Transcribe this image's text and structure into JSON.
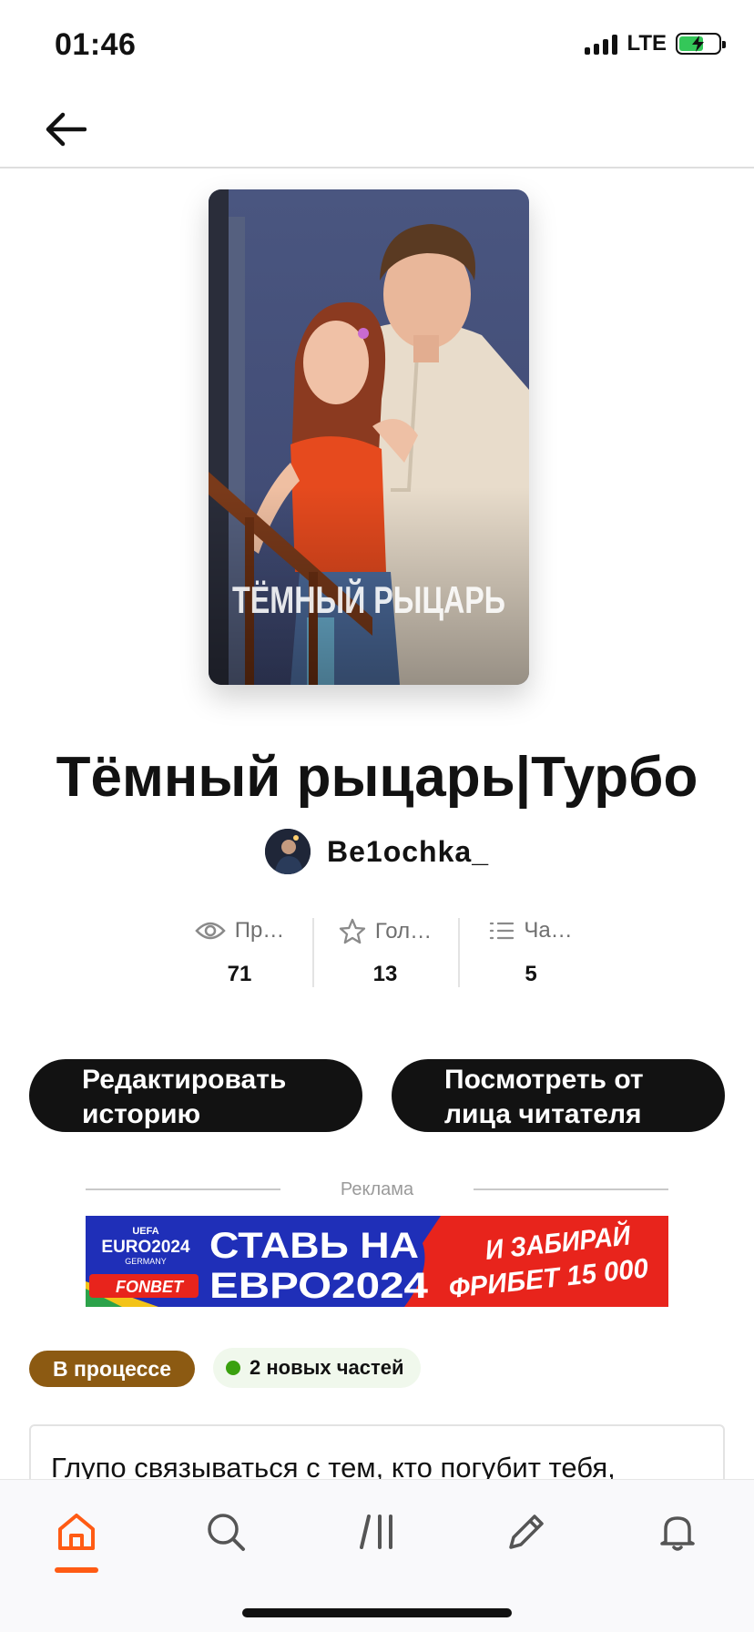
{
  "status_bar": {
    "time": "01:46",
    "network": "LTE"
  },
  "cover": {
    "overlay_text": "ТЁМНЫЙ РЫЦАРЬ"
  },
  "story": {
    "title": "Тёмный рыцарь|Турбо",
    "author": "Be1ochka_"
  },
  "stats": [
    {
      "icon": "eye-icon",
      "label": "Пр…",
      "value": "71"
    },
    {
      "icon": "star-icon",
      "label": "Гол…",
      "value": "13"
    },
    {
      "icon": "list-icon",
      "label": "Ча…",
      "value": "5"
    }
  ],
  "actions": {
    "edit_line1": "Редактировать",
    "edit_line2": "историю",
    "reader_line1": "Посмотреть от",
    "reader_line2": "лица читателя"
  },
  "ad": {
    "label": "Реклама",
    "uefa": "UEFA",
    "euro": "EURO2024",
    "germany": "GERMANY",
    "brand": "FONBET",
    "headline1": "СТАВЬ НА",
    "headline2": "ЕВРО2024",
    "promo1": "И ЗАБИРАЙ",
    "promo2": "ФРИБЕТ 15 000"
  },
  "badges": {
    "status": "В процессе",
    "new_parts": "2 новых частей"
  },
  "description": "Глупо связываться с тем, кто погубит тебя,",
  "tabs": [
    {
      "icon": "home-icon",
      "active": true
    },
    {
      "icon": "search-icon",
      "active": false
    },
    {
      "icon": "library-icon",
      "active": false
    },
    {
      "icon": "pencil-icon",
      "active": false
    },
    {
      "icon": "bell-icon",
      "active": false
    }
  ],
  "colors": {
    "accent": "#ff5b14",
    "status_chip": "#8c5a12",
    "new_dot": "#3aa10f",
    "button": "#121212"
  }
}
